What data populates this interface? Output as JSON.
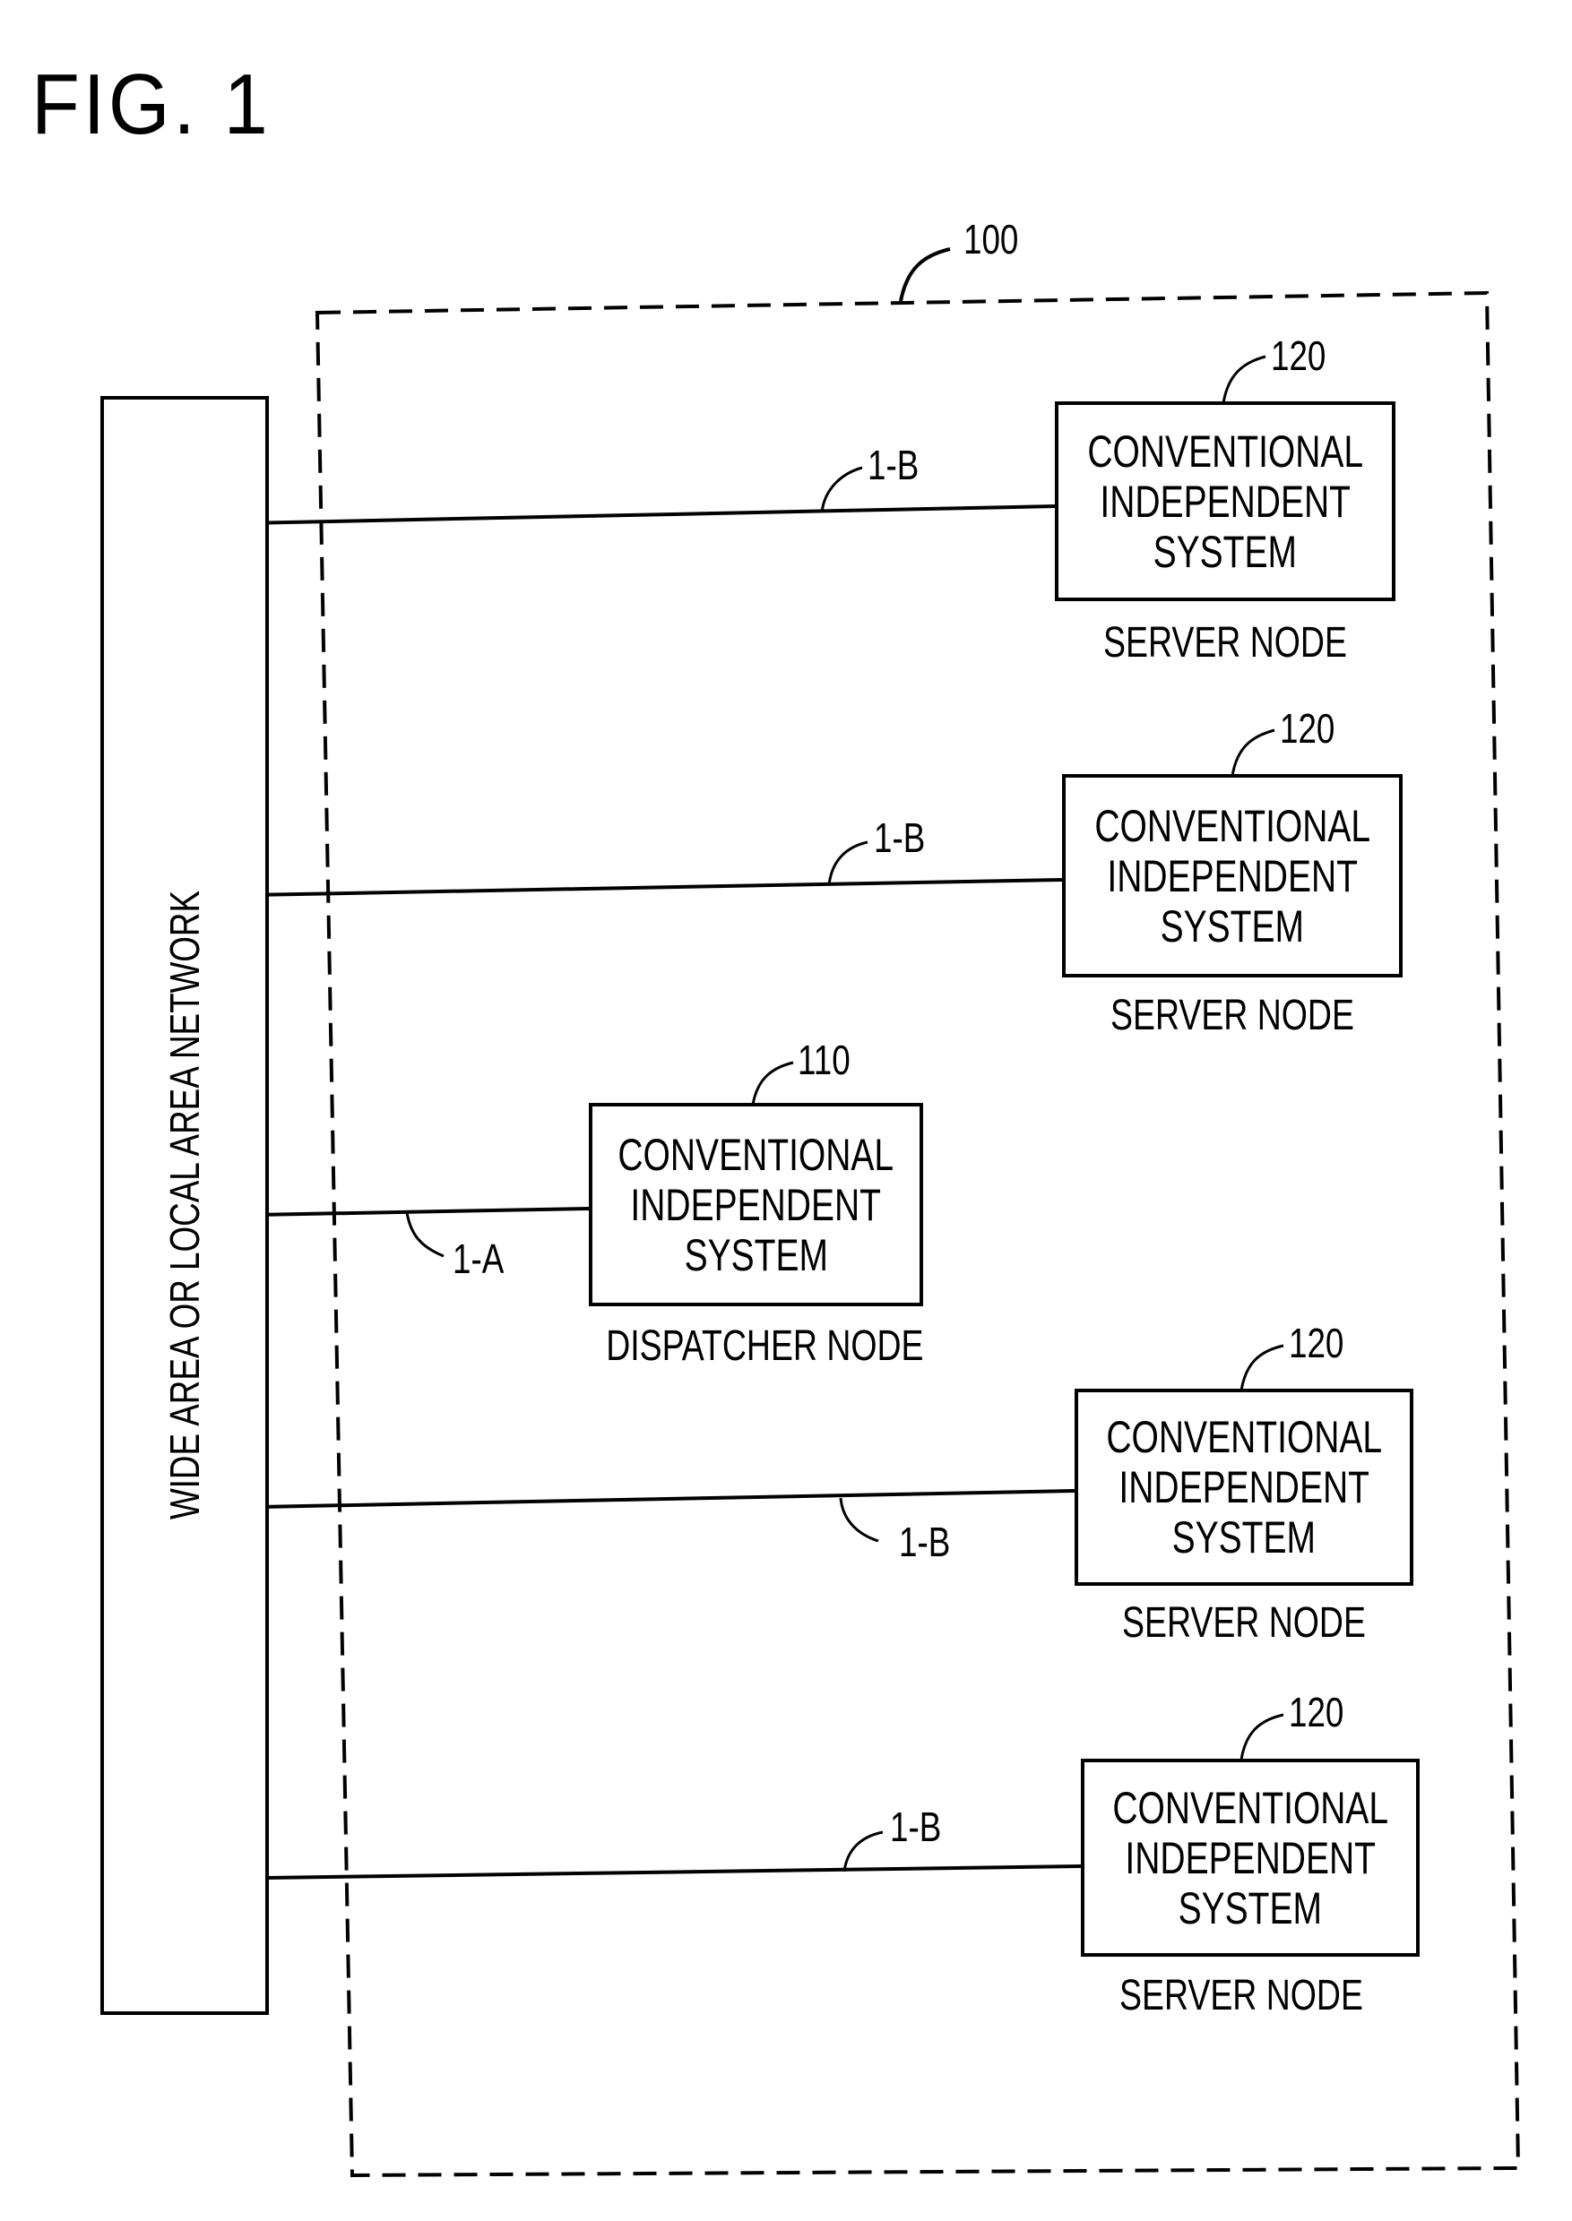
{
  "figure": {
    "title": "FIG. 1"
  },
  "system": {
    "ref": "100"
  },
  "network": {
    "label": "WIDE AREA OR LOCAL AREA NETWORK"
  },
  "nodes": [
    {
      "ref": "120",
      "lines": [
        "CONVENTIONAL",
        "INDEPENDENT",
        "SYSTEM"
      ],
      "caption": "SERVER NODE",
      "link_label": "1-B"
    },
    {
      "ref": "120",
      "lines": [
        "CONVENTIONAL",
        "INDEPENDENT",
        "SYSTEM"
      ],
      "caption": "SERVER NODE",
      "link_label": "1-B"
    },
    {
      "ref": "110",
      "lines": [
        "CONVENTIONAL",
        "INDEPENDENT",
        "SYSTEM"
      ],
      "caption": "DISPATCHER NODE",
      "link_label": "1-A"
    },
    {
      "ref": "120",
      "lines": [
        "CONVENTIONAL",
        "INDEPENDENT",
        "SYSTEM"
      ],
      "caption": "SERVER NODE",
      "link_label": "1-B"
    },
    {
      "ref": "120",
      "lines": [
        "CONVENTIONAL",
        "INDEPENDENT",
        "SYSTEM"
      ],
      "caption": "SERVER NODE",
      "link_label": "1-B"
    }
  ]
}
